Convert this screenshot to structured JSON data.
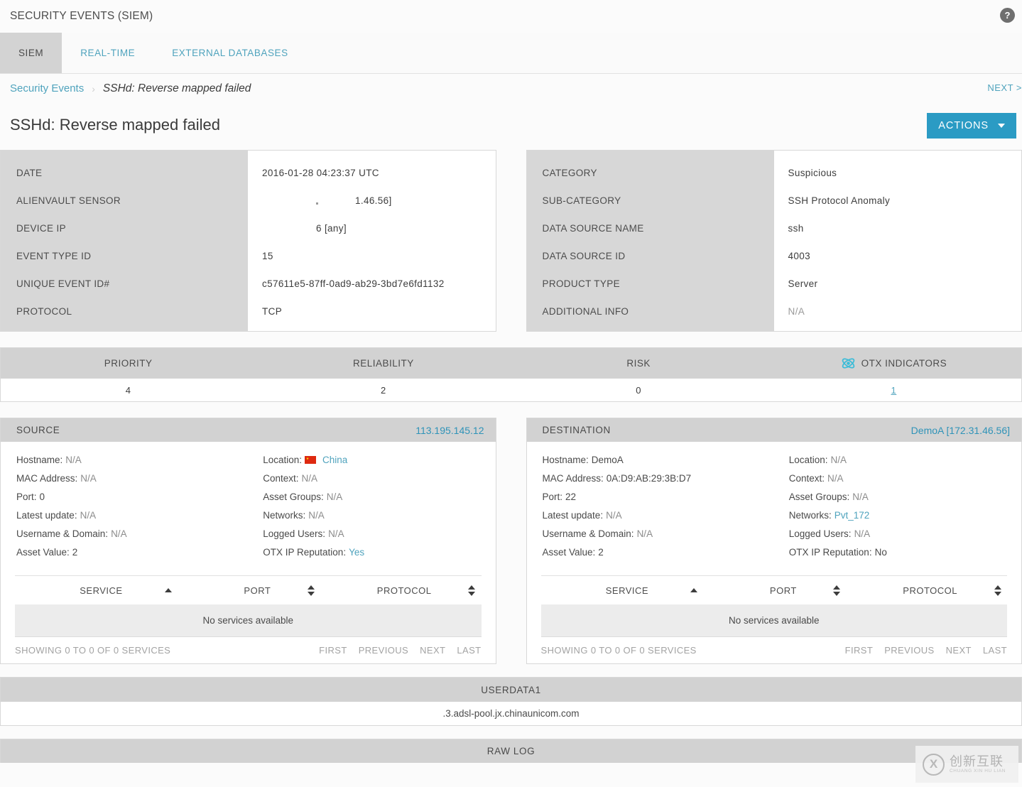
{
  "header": {
    "app_title": "SECURITY EVENTS (SIEM)",
    "help_icon_label": "?"
  },
  "tabs": [
    {
      "label": "SIEM",
      "active": true
    },
    {
      "label": "REAL-TIME",
      "active": false
    },
    {
      "label": "EXTERNAL DATABASES",
      "active": false
    }
  ],
  "breadcrumb": {
    "root": "Security Events",
    "separator": "›",
    "current": "SSHd: Reverse mapped failed",
    "next_label": "NEXT >"
  },
  "title_row": {
    "page_title": "SSHd: Reverse mapped failed",
    "actions_label": "ACTIONS"
  },
  "event_left": [
    {
      "label": "DATE",
      "value": "2016-01-28 04:23:37 UTC",
      "dim": false
    },
    {
      "label": "ALIENVAULT SENSOR",
      "value": "1.46.56]",
      "dim": false,
      "indent": true
    },
    {
      "label": "DEVICE IP",
      "value": "6 [any]",
      "dim": false,
      "indent": true
    },
    {
      "label": "EVENT TYPE ID",
      "value": "15",
      "dim": false
    },
    {
      "label": "UNIQUE EVENT ID#",
      "value": "c57611e5-87ff-0ad9-ab29-3bd7e6fd1132",
      "dim": false
    },
    {
      "label": "PROTOCOL",
      "value": "TCP",
      "dim": false
    }
  ],
  "event_right": [
    {
      "label": "CATEGORY",
      "value": "Suspicious",
      "dim": false
    },
    {
      "label": "SUB-CATEGORY",
      "value": "SSH Protocol Anomaly",
      "dim": false
    },
    {
      "label": "DATA SOURCE NAME",
      "value": "ssh",
      "dim": false
    },
    {
      "label": "DATA SOURCE ID",
      "value": "4003",
      "dim": false
    },
    {
      "label": "PRODUCT TYPE",
      "value": "Server",
      "dim": false
    },
    {
      "label": "ADDITIONAL INFO",
      "value": "N/A",
      "dim": true
    }
  ],
  "scores": {
    "headers": [
      "PRIORITY",
      "RELIABILITY",
      "RISK",
      "OTX INDICATORS"
    ],
    "values": [
      "4",
      "2",
      "0",
      "1"
    ],
    "otx_icon": "otx-atom-icon",
    "otx_icon_color": "#3bbcd8",
    "otx_link": true
  },
  "source": {
    "panel_title": "SOURCE",
    "address": "113.195.145.12",
    "left_fields": [
      {
        "label": "Hostname:",
        "value": "N/A",
        "type": "dim"
      },
      {
        "label": "MAC Address:",
        "value": "N/A",
        "type": "dim"
      },
      {
        "label": "Port:",
        "value": "0",
        "type": "solid"
      },
      {
        "label": "Latest update:",
        "value": "N/A",
        "type": "dim"
      },
      {
        "label": "Username & Domain:",
        "value": "N/A",
        "type": "dim"
      },
      {
        "label": "Asset Value:",
        "value": "2",
        "type": "solid"
      }
    ],
    "right_fields": [
      {
        "label": "Location:",
        "value": "China",
        "type": "link",
        "flag": "china-flag-icon"
      },
      {
        "label": "Context:",
        "value": "N/A",
        "type": "dim"
      },
      {
        "label": "Asset Groups:",
        "value": "N/A",
        "type": "dim"
      },
      {
        "label": "Networks:",
        "value": "N/A",
        "type": "dim"
      },
      {
        "label": "Logged Users:",
        "value": "N/A",
        "type": "dim"
      },
      {
        "label": "OTX IP Reputation:",
        "value": "Yes",
        "type": "link"
      }
    ],
    "table": {
      "columns": [
        "SERVICE",
        "PORT",
        "PROTOCOL"
      ],
      "sort": [
        "asc",
        "both",
        "both"
      ],
      "empty_text": "No services available",
      "showing": "SHOWING 0 TO 0 OF 0 SERVICES",
      "pager": [
        "FIRST",
        "PREVIOUS",
        "NEXT",
        "LAST"
      ]
    }
  },
  "destination": {
    "panel_title": "DESTINATION",
    "address": "DemoA [172.31.46.56]",
    "left_fields": [
      {
        "label": "Hostname:",
        "value": "DemoA",
        "type": "solid"
      },
      {
        "label": "MAC Address:",
        "value": "0A:D9:AB:29:3B:D7",
        "type": "solid"
      },
      {
        "label": "Port:",
        "value": "22",
        "type": "solid"
      },
      {
        "label": "Latest update:",
        "value": "N/A",
        "type": "dim"
      },
      {
        "label": "Username & Domain:",
        "value": "N/A",
        "type": "dim"
      },
      {
        "label": "Asset Value:",
        "value": "2",
        "type": "solid"
      }
    ],
    "right_fields": [
      {
        "label": "Location:",
        "value": "N/A",
        "type": "dim"
      },
      {
        "label": "Context:",
        "value": "N/A",
        "type": "dim"
      },
      {
        "label": "Asset Groups:",
        "value": "N/A",
        "type": "dim"
      },
      {
        "label": "Networks:",
        "value": "Pvt_172",
        "type": "link"
      },
      {
        "label": "Logged Users:",
        "value": "N/A",
        "type": "dim"
      },
      {
        "label": "OTX IP Reputation:",
        "value": "No",
        "type": "solid"
      }
    ],
    "table": {
      "columns": [
        "SERVICE",
        "PORT",
        "PROTOCOL"
      ],
      "sort": [
        "asc",
        "both",
        "both"
      ],
      "empty_text": "No services available",
      "showing": "SHOWING 0 TO 0 OF 0 SERVICES",
      "pager": [
        "FIRST",
        "PREVIOUS",
        "NEXT",
        "LAST"
      ]
    }
  },
  "userdata": {
    "header": "USERDATA1",
    "value": ".3.adsl-pool.jx.chinaunicom.com"
  },
  "raw_log": {
    "header": "RAW LOG"
  },
  "watermark": {
    "cn": "创新互联",
    "pinyin": "CHUANG XIN HU LIAN"
  },
  "colors": {
    "accent_link": "#4fa3bd",
    "actions_button": "#2b9bc4",
    "panel_label_bg": "#d7d7d7",
    "header_strip_bg": "#d2d2d2",
    "otx_icon": "#3bbcd8"
  }
}
